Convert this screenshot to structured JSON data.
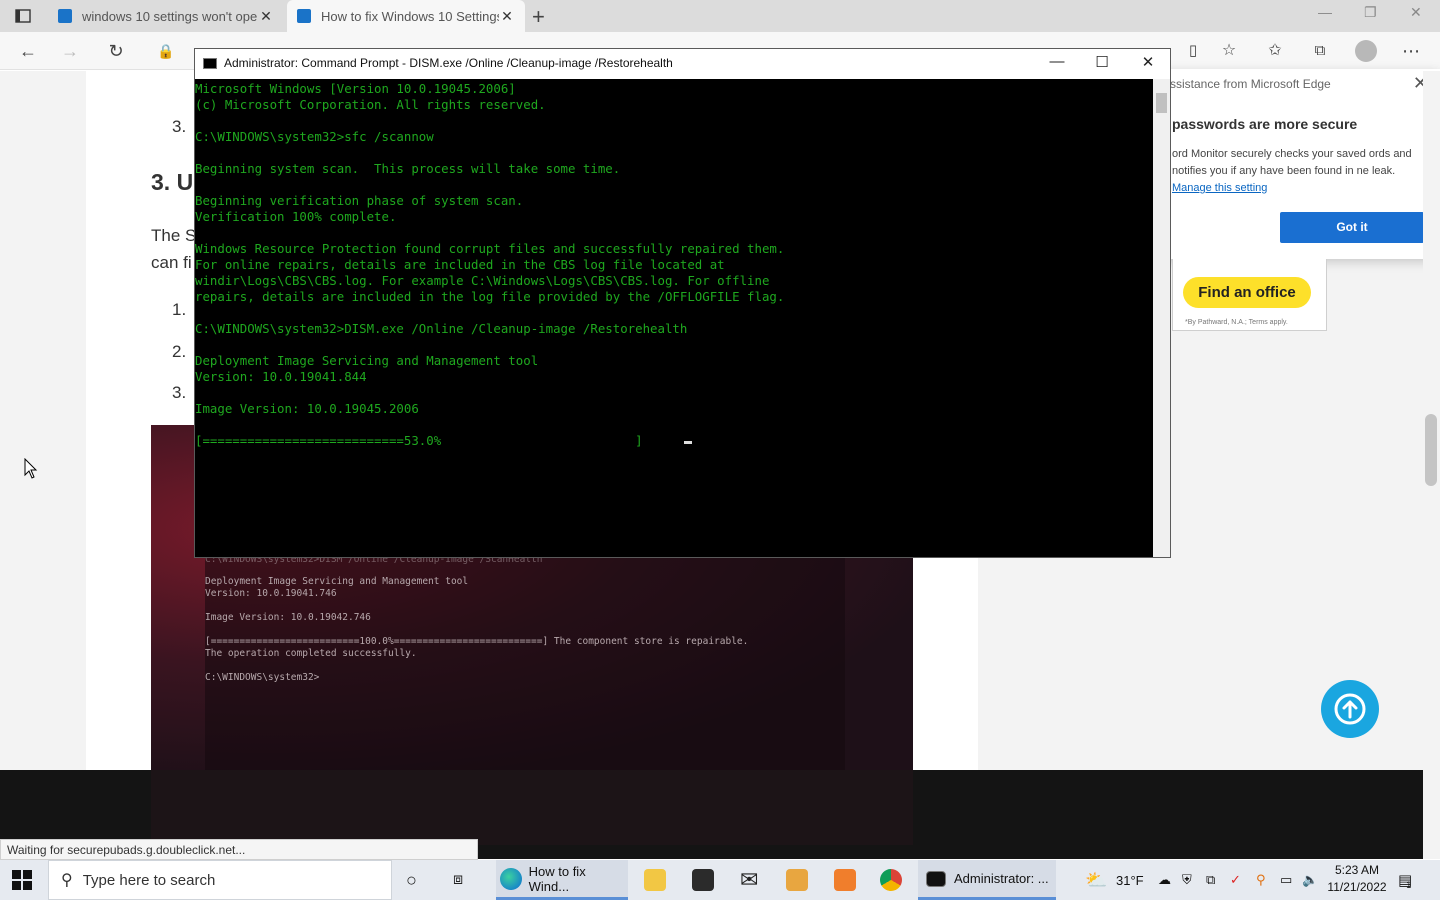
{
  "browser": {
    "tabs": [
      {
        "title": "windows 10 settings won't open",
        "close": "✕"
      },
      {
        "title": "How to fix Windows 10 Settings",
        "close": "✕"
      }
    ],
    "new_tab": "+",
    "status_text": "Waiting for securepubads.g.doubleclick.net..."
  },
  "article": {
    "heading": "3. U",
    "para_line1": "The S",
    "para_line2": "can fi",
    "list_top": "3.",
    "list": [
      "1.",
      "2.",
      "3."
    ],
    "image_text": {
      "line0": "C:\\WINDOWS\\system32>DISM /Online /Cleanup-Image /ScanHealth",
      "line1": "Deployment Image Servicing and Management tool",
      "line2": "Version: 10.0.19041.746",
      "line3": "Image Version: 10.0.19042.746",
      "line4": "[==========================100.0%==========================] The component store is repairable.",
      "line5": "The operation completed successfully.",
      "line6": "C:\\WINDOWS\\system32>"
    }
  },
  "notification": {
    "header": "ssistance from Microsoft Edge",
    "title": "passwords are more secure",
    "body": "ord Monitor securely checks your saved ords and notifies you if any have been found in ne leak.",
    "link": "Manage this setting",
    "button": "Got it"
  },
  "ad": {
    "button": "Find an office",
    "fine_print": "*By Pathward, N.A.; Terms apply."
  },
  "cmd": {
    "title": "Administrator: Command Prompt - DISM.exe  /Online /Cleanup-image /Restorehealth",
    "lines": [
      "Microsoft Windows [Version 10.0.19045.2006]",
      "(c) Microsoft Corporation. All rights reserved.",
      "",
      "C:\\WINDOWS\\system32>sfc /scannow",
      "",
      "Beginning system scan.  This process will take some time.",
      "",
      "Beginning verification phase of system scan.",
      "Verification 100% complete.",
      "",
      "Windows Resource Protection found corrupt files and successfully repaired them.",
      "For online repairs, details are included in the CBS log file located at",
      "windir\\Logs\\CBS\\CBS.log. For example C:\\Windows\\Logs\\CBS\\CBS.log. For offline",
      "repairs, details are included in the log file provided by the /OFFLOGFILE flag.",
      "",
      "C:\\WINDOWS\\system32>DISM.exe /Online /Cleanup-image /Restorehealth",
      "",
      "Deployment Image Servicing and Management tool",
      "Version: 10.0.19041.844",
      "",
      "Image Version: 10.0.19045.2006",
      "",
      "[===========================53.0%                          ]"
    ]
  },
  "taskbar": {
    "search_placeholder": "Type here to search",
    "edge_label": "How to fix Wind...",
    "cmd_label": "Administrator: ...",
    "temperature": "31°F",
    "time": "5:23 AM",
    "date": "11/21/2022",
    "notif_count": "1"
  },
  "colors": {
    "console_text": "#1fa81f",
    "accent": "#1a6fd1",
    "ad_button": "#fde02a",
    "scroll_top": "#1aa6e0"
  }
}
